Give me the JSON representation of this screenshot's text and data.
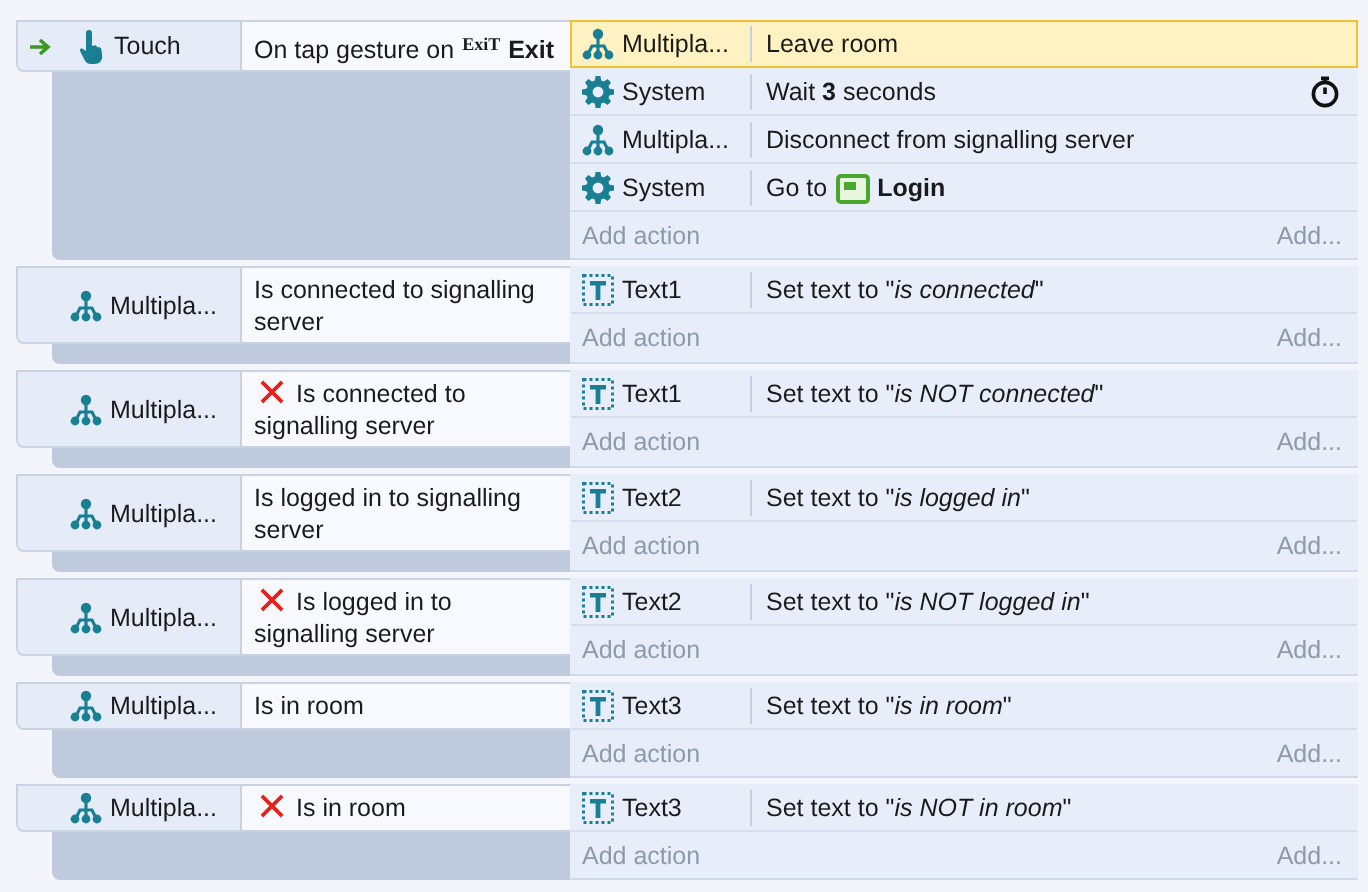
{
  "events": [
    {
      "conditions": [
        {
          "kind": "touch",
          "object": "Touch",
          "trigger": true,
          "inverted": false,
          "text": "On tap gesture on",
          "param": {
            "sprite": "ExiT",
            "name": "Exit"
          }
        }
      ],
      "actions": [
        {
          "kind": "multiplayer",
          "object": "Multipla...",
          "text": "Leave room",
          "selected": true,
          "timer": false
        },
        {
          "kind": "system",
          "object": "System",
          "text": "Wait **3** seconds",
          "selected": false,
          "timer": true
        },
        {
          "kind": "multiplayer",
          "object": "Multipla...",
          "text": "Disconnect from signalling server",
          "selected": false,
          "timer": false
        },
        {
          "kind": "system",
          "object": "System",
          "text": "Go to",
          "selected": false,
          "timer": false,
          "layout": "Login"
        }
      ],
      "add_action": "Add action",
      "add_more": "Add..."
    },
    {
      "conditions": [
        {
          "kind": "multiplayer",
          "object": "Multipla...",
          "trigger": false,
          "inverted": false,
          "text": "Is connected to signalling server"
        }
      ],
      "actions": [
        {
          "kind": "text",
          "object": "Text1",
          "text": "Set text to \"*is connected*\"",
          "selected": false,
          "timer": false
        }
      ],
      "add_action": "Add action",
      "add_more": "Add..."
    },
    {
      "conditions": [
        {
          "kind": "multiplayer",
          "object": "Multipla...",
          "trigger": false,
          "inverted": true,
          "text": "Is connected to signalling server"
        }
      ],
      "actions": [
        {
          "kind": "text",
          "object": "Text1",
          "text": "Set text to \"*is NOT connected*\"",
          "selected": false,
          "timer": false
        }
      ],
      "add_action": "Add action",
      "add_more": "Add..."
    },
    {
      "conditions": [
        {
          "kind": "multiplayer",
          "object": "Multipla...",
          "trigger": false,
          "inverted": false,
          "text": "Is logged in to signalling server"
        }
      ],
      "actions": [
        {
          "kind": "text",
          "object": "Text2",
          "text": "Set text to \"*is logged in*\"",
          "selected": false,
          "timer": false
        }
      ],
      "add_action": "Add action",
      "add_more": "Add..."
    },
    {
      "conditions": [
        {
          "kind": "multiplayer",
          "object": "Multipla...",
          "trigger": false,
          "inverted": true,
          "text": "Is logged in to signalling server"
        }
      ],
      "actions": [
        {
          "kind": "text",
          "object": "Text2",
          "text": "Set text to \"*is NOT logged in*\"",
          "selected": false,
          "timer": false
        }
      ],
      "add_action": "Add action",
      "add_more": "Add..."
    },
    {
      "conditions": [
        {
          "kind": "multiplayer",
          "object": "Multipla...",
          "trigger": false,
          "inverted": false,
          "text": "Is in room"
        }
      ],
      "actions": [
        {
          "kind": "text",
          "object": "Text3",
          "text": "Set text to \"*is in room*\"",
          "selected": false,
          "timer": false
        }
      ],
      "add_action": "Add action",
      "add_more": "Add..."
    },
    {
      "conditions": [
        {
          "kind": "multiplayer",
          "object": "Multipla...",
          "trigger": false,
          "inverted": true,
          "text": "Is in room"
        }
      ],
      "actions": [
        {
          "kind": "text",
          "object": "Text3",
          "text": "Set text to \"*is NOT in room*\"",
          "selected": false,
          "timer": false
        }
      ],
      "add_action": "Add action",
      "add_more": "Add..."
    }
  ]
}
